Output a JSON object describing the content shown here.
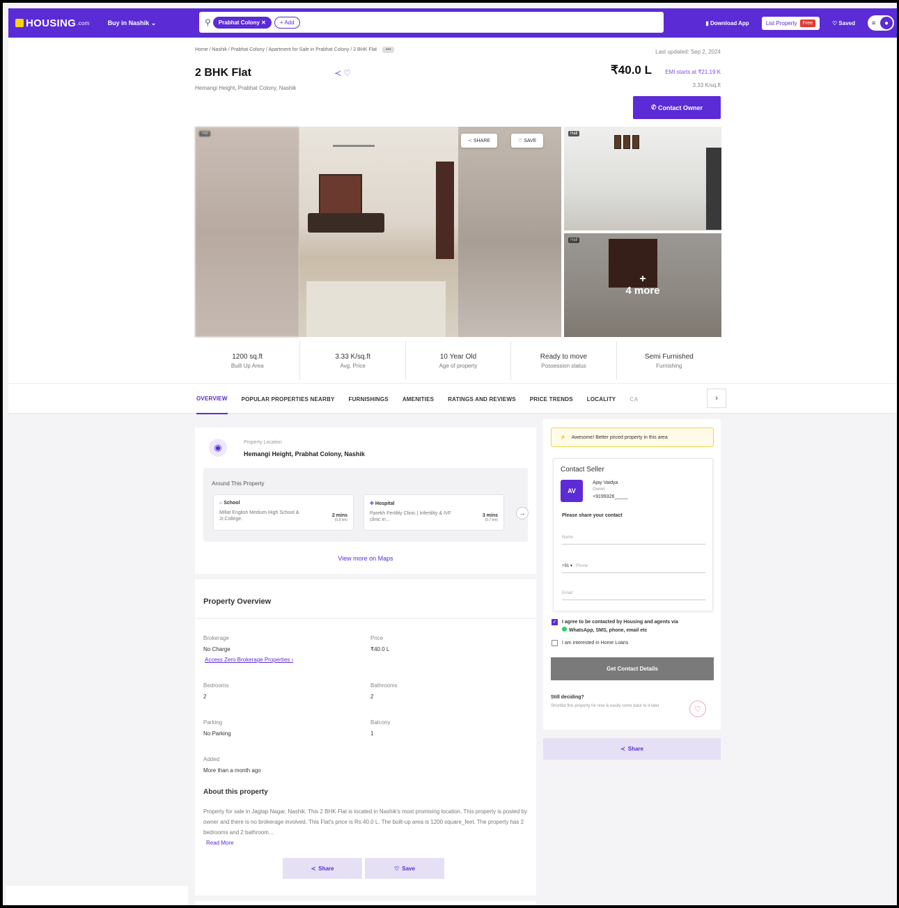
{
  "topbar": {
    "logo": "HOUSING",
    "logo_suffix": ".com",
    "city": "Buy in Nashik",
    "chip": "Prabhat Colony",
    "chip_add": "+ Add",
    "download": "Download App",
    "list_property": "List Property",
    "free": "Free",
    "saved": "Saved"
  },
  "breadcrumb": "Home / Nashik / Prabhat Colony / Apartment for Sale in Prabhat Colony / 2 BHK Flat",
  "updated": "Last updated: Sep 2, 2024",
  "listing": {
    "title": "2 BHK Flat",
    "address": "Hemangi Height, Prabhat Colony, Nashik",
    "price": "₹40.0 L",
    "emi": "EMI starts at ₹21.19 K",
    "per_sqft": "3.33 K/sq.ft",
    "contact_owner": "Contact Owner"
  },
  "gallery": {
    "tag": "Hall",
    "share": "SHARE",
    "save": "SAVE",
    "more_plus": "+",
    "more_text": "4 more"
  },
  "specs": [
    {
      "value": "1200 sq.ft",
      "label": "Built Up Area"
    },
    {
      "value": "3.33 K/sq.ft",
      "label": "Avg. Price"
    },
    {
      "value": "10 Year Old",
      "label": "Age of property"
    },
    {
      "value": "Ready to move",
      "label": "Possession status"
    },
    {
      "value": "Semi Furnished",
      "label": "Furnishing"
    }
  ],
  "tabs": [
    "OVERVIEW",
    "POPULAR PROPERTIES NEARBY",
    "FURNISHINGS",
    "AMENITIES",
    "RATINGS AND REVIEWS",
    "PRICE TRENDS",
    "LOCALITY",
    "CA"
  ],
  "location": {
    "label": "Property Location",
    "value": "Hemangi Height, Prabhat Colony, Nashik",
    "around_title": "Around This Property",
    "nearby": [
      {
        "category": "School",
        "name": "Millat English Medium High School & Jr.College.",
        "time": "2 mins",
        "distance": "(0.8 km)"
      },
      {
        "category": "Hospital",
        "name": "Parekh Fertility Clinic | Infertility & IVF clinic in...",
        "time": "3 mins",
        "distance": "(0.7 km)"
      }
    ],
    "view_maps": "View more on Maps"
  },
  "overview": {
    "title": "Property Overview",
    "brokerage_label": "Brokerage",
    "brokerage_value": "No Charge",
    "brokerage_link": "Access Zero Brokerage Properties ›",
    "price_label": "Price",
    "price_value": "₹40.0 L",
    "bedrooms_label": "Bedrooms",
    "bedrooms_value": "2",
    "bathrooms_label": "Bathrooms",
    "bathrooms_value": "2",
    "parking_label": "Parking",
    "parking_value": "No Parking",
    "balcony_label": "Balcony",
    "balcony_value": "1",
    "added_label": "Added",
    "added_value": "More than a month ago",
    "about_title": "About this property",
    "about_text": "Property for sale in Jagtap Nagar, Nashik. This 2 BHK Flat is located in Nashik's most promising location. This property is posted by owner and there is no brokerage involved. This Flat's price is Rs 40.0 L. The built-up area is 1200 square_feet. The property has 2 bedrooms and 2 bathroom...",
    "read_more": "Read More",
    "share": "Share",
    "save": "Save"
  },
  "seller": {
    "banner": "Awesome! Better priced property in this area",
    "title": "Contact Seller",
    "initials": "AV",
    "name": "Ajay Vaidya",
    "role": "Owner",
    "phone": "+9199326_____",
    "share_contact": "Please share your contact",
    "name_ph": "Name",
    "code": "+91",
    "phone_ph": "Phone",
    "email_ph": "Email",
    "consent": "I agree to be contacted by Housing and agents via",
    "consent2": "WhatsApp, SMS, phone, email etc",
    "home_loans": "I am interested in Home Loans",
    "get_details": "Get Contact Details",
    "still_title": "Still deciding?",
    "still_text": "Shortlist this property for now & easily come back to it later",
    "share": "Share"
  },
  "colors": {
    "brand": "#5b2bd6"
  }
}
